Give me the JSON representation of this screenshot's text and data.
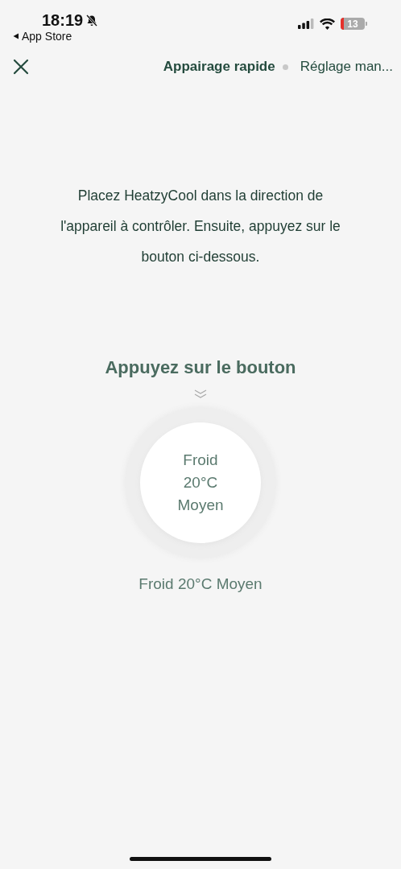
{
  "status_bar": {
    "time": "18:19",
    "back_label": "App Store",
    "battery": "13"
  },
  "tabs": [
    {
      "label": "Appairage rapide",
      "selected": true
    },
    {
      "label": "Réglage man...",
      "selected": false
    }
  ],
  "instructions": "Placez HeatzyCool dans la direction de l'appareil à contrôler. Ensuite, appuyez sur le bouton ci-dessous.",
  "prompt": "Appuyez sur le bouton",
  "button": {
    "lines": [
      "Froid",
      "20°C",
      "Moyen"
    ]
  },
  "caption": "Froid 20°C Moyen"
}
